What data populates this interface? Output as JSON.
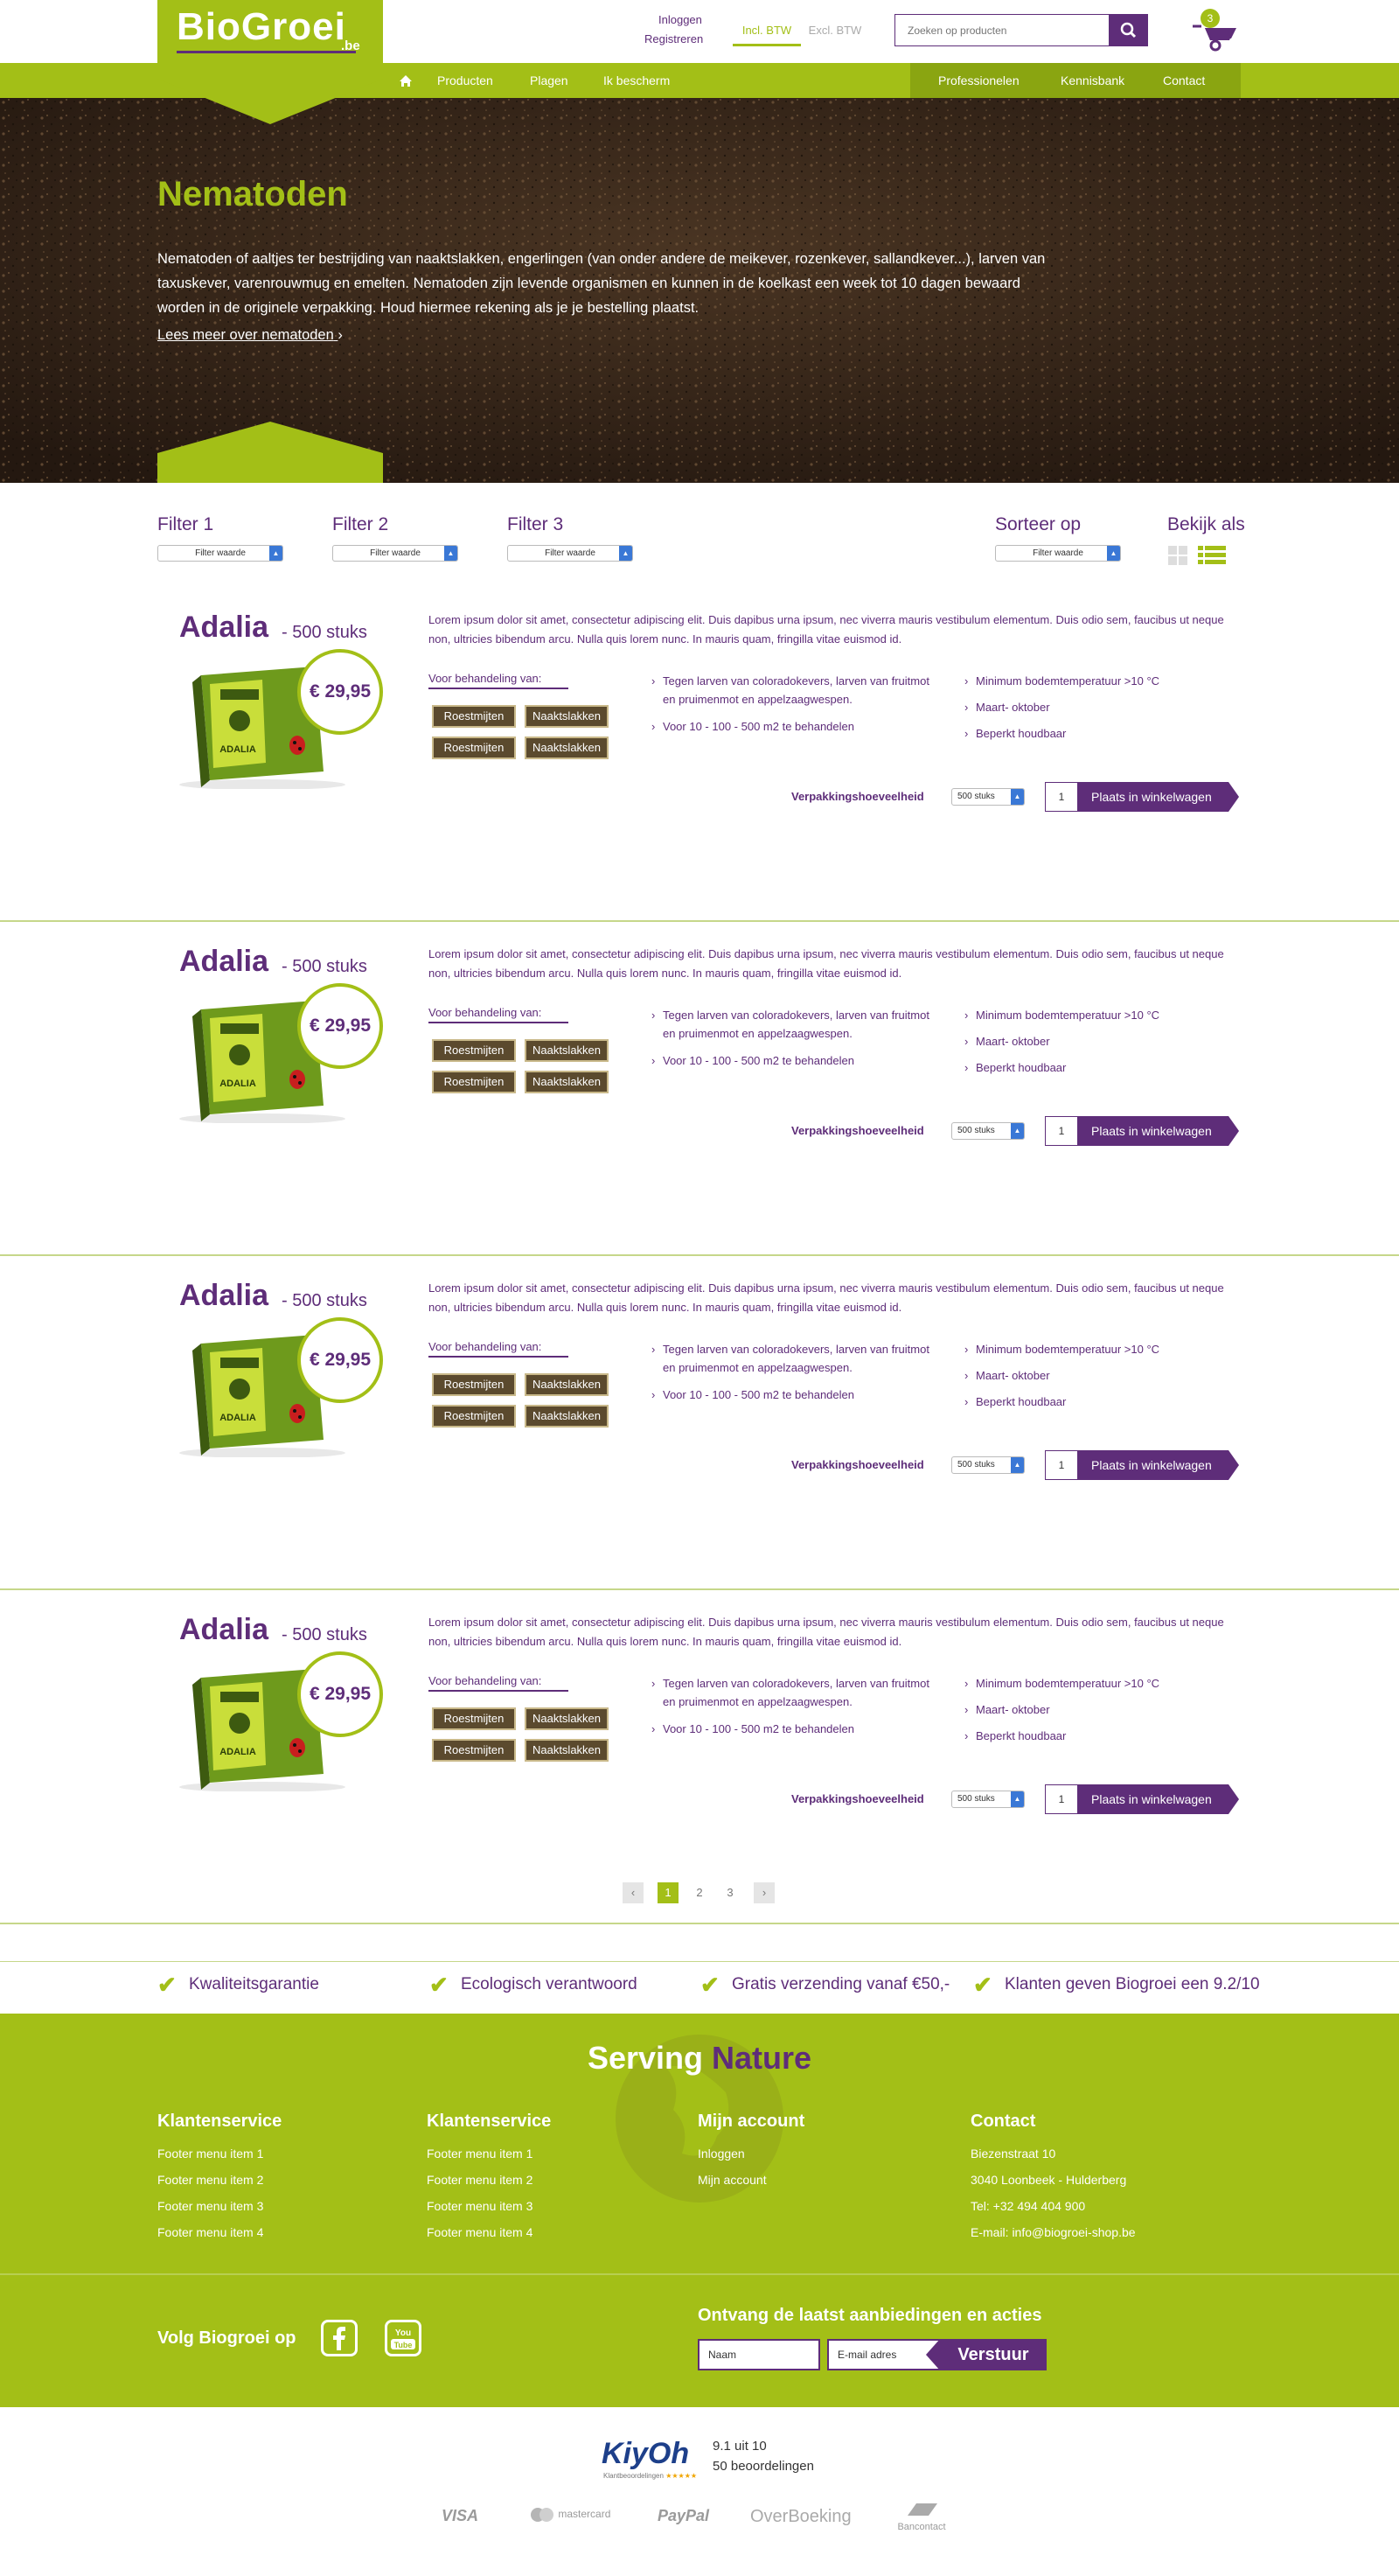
{
  "brand": {
    "logo_main": "Bio",
    "logo_accent": "Groei",
    "logo_tld": ".be"
  },
  "header": {
    "login": "Inloggen",
    "register": "Registreren",
    "btw_incl": "Incl. BTW",
    "btw_excl": "Excl. BTW",
    "search_placeholder": "Zoeken op producten",
    "cart_count": "3"
  },
  "nav": {
    "left": [
      "Producten",
      "Plagen",
      "Ik bescherm"
    ],
    "right": [
      "Professionelen",
      "Kennisbank",
      "Contact"
    ]
  },
  "hero": {
    "title": "Nematoden",
    "text": "Nematoden of aaltjes ter bestrijding van naaktslakken, engerlingen (van onder andere de meikever, rozenkever, sallandkever...), larven van taxuskever, varenrouwmug en emelten. Nematoden zijn levende organismen en kunnen in de koelkast een week tot 10 dagen bewaard worden in de originele verpakking. Houd hiermee rekening als je je bestelling plaatst.",
    "more": "Lees meer over nematoden"
  },
  "filters": {
    "items": [
      {
        "label": "Filter 1",
        "value": "Filter waarde"
      },
      {
        "label": "Filter 2",
        "value": "Filter waarde"
      },
      {
        "label": "Filter 3",
        "value": "Filter waarde"
      }
    ],
    "sort_label": "Sorteer op",
    "sort_value": "Filter waarde",
    "view_label": "Bekijk als"
  },
  "products": [
    {
      "name": "Adalia",
      "sub": "- 500 stuks",
      "price": "€ 29,95",
      "desc": "Lorem ipsum dolor sit amet, consectetur adipiscing elit. Duis dapibus urna ipsum, nec viverra mauris vestibulum elementum. Duis odio sem, faucibus ut neque non, ultricies bibendum arcu. Nulla quis lorem nunc. In mauris quam, fringilla vitae euismod id.",
      "treat_label": "Voor behandeling van:",
      "tags": [
        "Roestmijten",
        "Naaktslakken",
        "Roestmijten",
        "Naaktslakken"
      ],
      "bullets_a": [
        "Tegen larven van coloradokevers, larven van fruitmot en pruimenmot en appelzaagwespen.",
        "Voor 10 - 100 - 500 m2 te behandelen"
      ],
      "bullets_b": [
        "Minimum bodemtemperatuur >10 °C",
        "Maart- oktober",
        "Beperkt houdbaar"
      ],
      "pack_label": "Verpakkingshoeveelheid",
      "pack_value": "500 stuks",
      "qty": "1",
      "cart_label": "Plaats in winkelwagen"
    },
    {
      "name": "Adalia",
      "sub": "- 500 stuks",
      "price": "€ 29,95",
      "desc": "Lorem ipsum dolor sit amet, consectetur adipiscing elit. Duis dapibus urna ipsum, nec viverra mauris vestibulum elementum. Duis odio sem, faucibus ut neque non, ultricies bibendum arcu. Nulla quis lorem nunc. In mauris quam, fringilla vitae euismod id.",
      "treat_label": "Voor behandeling van:",
      "tags": [
        "Roestmijten",
        "Naaktslakken",
        "Roestmijten",
        "Naaktslakken"
      ],
      "bullets_a": [
        "Tegen larven van coloradokevers, larven van fruitmot en pruimenmot en appelzaagwespen.",
        "Voor 10 - 100 - 500 m2 te behandelen"
      ],
      "bullets_b": [
        "Minimum bodemtemperatuur >10 °C",
        "Maart- oktober",
        "Beperkt houdbaar"
      ],
      "pack_label": "Verpakkingshoeveelheid",
      "pack_value": "500 stuks",
      "qty": "1",
      "cart_label": "Plaats in winkelwagen"
    },
    {
      "name": "Adalia",
      "sub": "- 500 stuks",
      "price": "€ 29,95",
      "desc": "Lorem ipsum dolor sit amet, consectetur adipiscing elit. Duis dapibus urna ipsum, nec viverra mauris vestibulum elementum. Duis odio sem, faucibus ut neque non, ultricies bibendum arcu. Nulla quis lorem nunc. In mauris quam, fringilla vitae euismod id.",
      "treat_label": "Voor behandeling van:",
      "tags": [
        "Roestmijten",
        "Naaktslakken",
        "Roestmijten",
        "Naaktslakken"
      ],
      "bullets_a": [
        "Tegen larven van coloradokevers, larven van fruitmot en pruimenmot en appelzaagwespen.",
        "Voor 10 - 100 - 500 m2 te behandelen"
      ],
      "bullets_b": [
        "Minimum bodemtemperatuur >10 °C",
        "Maart- oktober",
        "Beperkt houdbaar"
      ],
      "pack_label": "Verpakkingshoeveelheid",
      "pack_value": "500 stuks",
      "qty": "1",
      "cart_label": "Plaats in winkelwagen"
    },
    {
      "name": "Adalia",
      "sub": "- 500 stuks",
      "price": "€ 29,95",
      "desc": "Lorem ipsum dolor sit amet, consectetur adipiscing elit. Duis dapibus urna ipsum, nec viverra mauris vestibulum elementum. Duis odio sem, faucibus ut neque non, ultricies bibendum arcu. Nulla quis lorem nunc. In mauris quam, fringilla vitae euismod id.",
      "treat_label": "Voor behandeling van:",
      "tags": [
        "Roestmijten",
        "Naaktslakken",
        "Roestmijten",
        "Naaktslakken"
      ],
      "bullets_a": [
        "Tegen larven van coloradokevers, larven van fruitmot en pruimenmot en appelzaagwespen.",
        "Voor 10 - 100 - 500 m2 te behandelen"
      ],
      "bullets_b": [
        "Minimum bodemtemperatuur >10 °C",
        "Maart- oktober",
        "Beperkt houdbaar"
      ],
      "pack_label": "Verpakkingshoeveelheid",
      "pack_value": "500 stuks",
      "qty": "1",
      "cart_label": "Plaats in winkelwagen"
    }
  ],
  "pagination": {
    "pages": [
      "1",
      "2",
      "3"
    ],
    "current": "1"
  },
  "usps": [
    "Kwaliteitsgarantie",
    "Ecologisch verantwoord",
    "Gratis verzending vanaf €50,-",
    "Klanten geven Biogroei een 9.2/10"
  ],
  "footer": {
    "serving_a": "Serving",
    "serving_b": "Nature",
    "columns": [
      {
        "title": "Klantenservice",
        "links": [
          "Footer menu item 1",
          "Footer menu item 2",
          "Footer menu item 3",
          "Footer menu item 4"
        ]
      },
      {
        "title": "Klantenservice",
        "links": [
          "Footer menu item 1",
          "Footer menu item 2",
          "Footer menu item 3",
          "Footer menu item 4"
        ]
      },
      {
        "title": "Mijn account",
        "links": [
          "Inloggen",
          "Mijn account"
        ]
      },
      {
        "title": "Contact",
        "links": [
          "Biezenstraat 10",
          "3040 Loonbeek - Hulderberg",
          "Tel: +32 494 404 900",
          "E-mail: info@biogroei-shop.be"
        ]
      }
    ],
    "follow": "Volg Biogroei op",
    "newsletter_title": "Ontvang de laatst aanbiedingen en acties",
    "name_placeholder": "Naam",
    "email_placeholder": "E-mail adres",
    "submit": "Verstuur"
  },
  "reviews": {
    "logo": "KiyOh",
    "logo_sub": "Klantbeoordelingen",
    "score": "9.1 uit 10",
    "count": "50 beoordelingen"
  },
  "payments": [
    "VISA",
    "mastercard",
    "PayPal",
    "OverBoeking",
    "Bancontact"
  ],
  "colors": {
    "green": "#a3bf17",
    "purple": "#5e2d79"
  }
}
